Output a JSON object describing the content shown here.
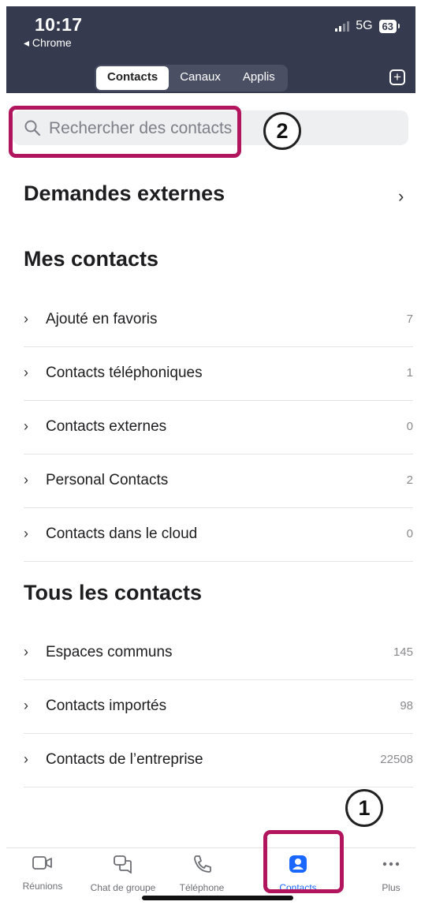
{
  "status_bar": {
    "time": "10:17",
    "back_app": "Chrome",
    "network": "5G",
    "battery": "63"
  },
  "tabs": [
    {
      "label": "Contacts",
      "active": true
    },
    {
      "label": "Canaux",
      "active": false
    },
    {
      "label": "Applis",
      "active": false
    }
  ],
  "search": {
    "placeholder": "Rechercher des contacts"
  },
  "external_requests": {
    "title": "Demandes externes"
  },
  "my_contacts": {
    "title": "Mes contacts",
    "items": [
      {
        "label": "Ajouté en favoris",
        "count": "7"
      },
      {
        "label": "Contacts téléphoniques",
        "count": "1"
      },
      {
        "label": "Contacts externes",
        "count": "0"
      },
      {
        "label": "Personal Contacts",
        "count": "2"
      },
      {
        "label": "Contacts dans le cloud",
        "count": "0"
      }
    ]
  },
  "all_contacts": {
    "title": "Tous les contacts",
    "items": [
      {
        "label": "Espaces communs",
        "count": "145"
      },
      {
        "label": "Contacts importés",
        "count": "98"
      },
      {
        "label": "Contacts de l’entreprise",
        "count": "22508"
      }
    ]
  },
  "bottom_nav": [
    {
      "label": "Réunions",
      "icon": "video-camera-icon"
    },
    {
      "label": "Chat de groupe",
      "icon": "chat-bubbles-icon"
    },
    {
      "label": "Téléphone",
      "icon": "phone-icon"
    },
    {
      "label": "Contacts",
      "icon": "contact-card-icon",
      "active": true
    },
    {
      "label": "Plus",
      "icon": "more-dots-icon"
    }
  ],
  "annotations": {
    "callout_1": "1",
    "callout_2": "2",
    "color": "#b0155e"
  },
  "colors": {
    "header_bg": "#363a4e",
    "accent": "#1a67ff"
  }
}
